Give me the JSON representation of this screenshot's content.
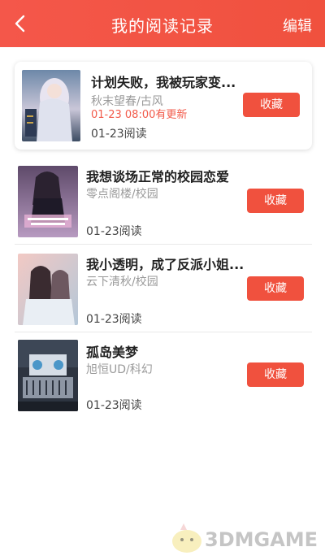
{
  "header": {
    "title": "我的阅读记录",
    "edit_label": "编辑"
  },
  "colors": {
    "brand": "#f0513e",
    "update": "#f25a4a"
  },
  "icons": {
    "back": "chevron-left-icon"
  },
  "books": [
    {
      "title": "计划失败，我被玩家变...",
      "meta": "秋末望春/古风",
      "update": "01-23 08:00有更新",
      "read": "01-23阅读",
      "button": "收藏"
    },
    {
      "title": "我想谈场正常的校园恋爱",
      "meta": "零点阁楼/校园",
      "read": "01-23阅读",
      "button": "收藏"
    },
    {
      "title": "我小透明，成了反派小姐...",
      "meta": "云下清秋/校园",
      "read": "01-23阅读",
      "button": "收藏"
    },
    {
      "title": "孤岛美梦",
      "meta": "旭恒UD/科幻",
      "read": "01-23阅读",
      "button": "收藏"
    }
  ],
  "watermark": {
    "text": "3DMGAME"
  }
}
